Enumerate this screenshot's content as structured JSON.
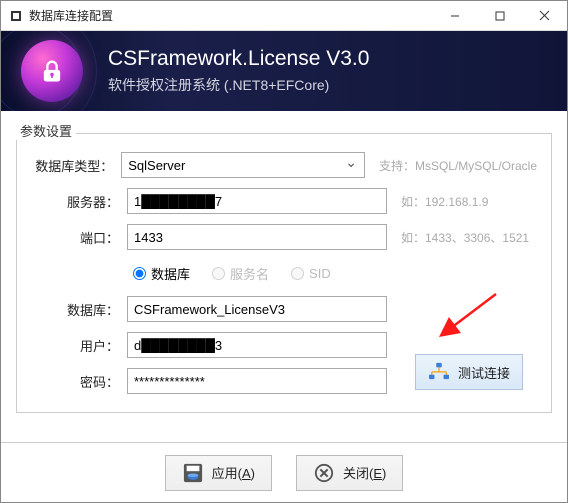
{
  "window": {
    "title": "数据库连接配置"
  },
  "banner": {
    "title": "CSFramework.License V3.0",
    "subtitle": "软件授权注册系统    (.NET8+EFCore)"
  },
  "fieldset_label": "参数设置",
  "labels": {
    "db_type": "数据库类型：",
    "server": "服务器：",
    "port": "端口：",
    "database": "数据库：",
    "user": "用户：",
    "password": "密码："
  },
  "radios": {
    "database": "数据库",
    "service_name": "服务名",
    "sid": "SID"
  },
  "values": {
    "db_type": "SqlServer",
    "server": "1████████7",
    "port": "1433",
    "database": "CSFramework_LicenseV3",
    "user": "d████████3",
    "password": "**************"
  },
  "hints": {
    "db_type": "支持：MsSQL/MySQL/Oracle",
    "server": "如：192.168.1.9",
    "port": "如：1433、3306、1521"
  },
  "buttons": {
    "test": "测试连接",
    "apply": "应用(",
    "apply_key": "A",
    "apply_end": ")",
    "close": "关闭(",
    "close_key": "E",
    "close_end": ")"
  }
}
